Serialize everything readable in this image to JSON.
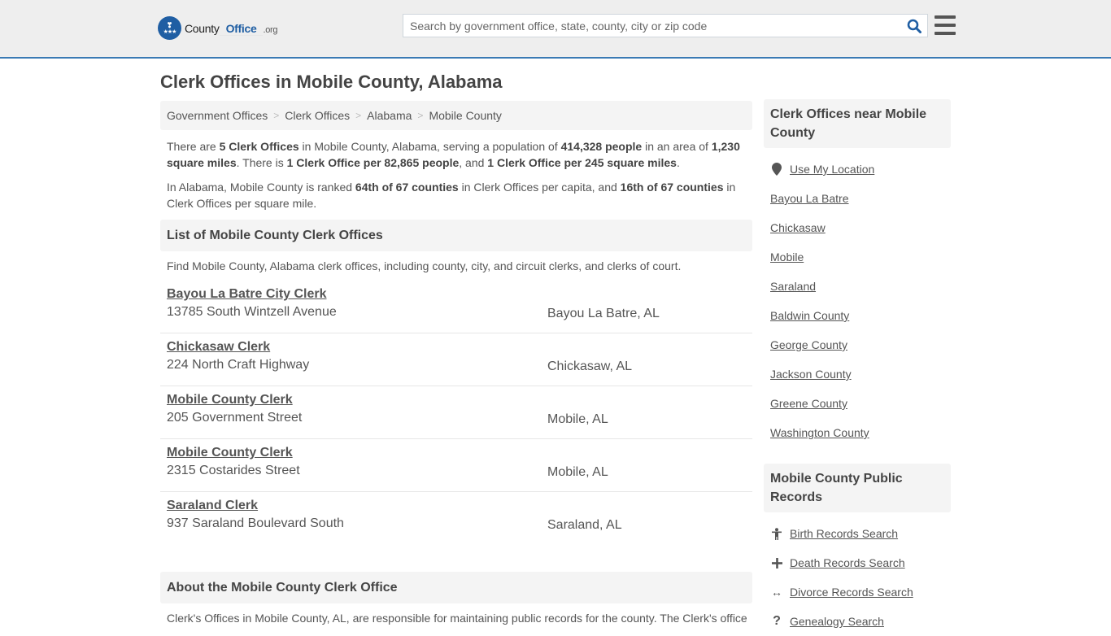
{
  "header": {
    "logo": {
      "county": "County",
      "office": "Office",
      "org": ".org"
    },
    "search": {
      "placeholder": "Search by government office, state, county, city or zip code",
      "value": ""
    },
    "colors": {
      "brand": "#1f5ea3",
      "header_bg": "#eeeeee",
      "header_border": "#3a7ab4"
    }
  },
  "page": {
    "title": "Clerk Offices in Mobile County, Alabama"
  },
  "breadcrumb": [
    {
      "label": "Government Offices"
    },
    {
      "label": "Clerk Offices"
    },
    {
      "label": "Alabama"
    },
    {
      "label": "Mobile County"
    }
  ],
  "intro": {
    "p1": {
      "t1": "There are ",
      "b1": "5 Clerk Offices",
      "t2": " in Mobile County, Alabama, serving a population of ",
      "b2": "414,328 people",
      "t3": " in an area of ",
      "b3": "1,230 square miles",
      "t4": ". There is ",
      "b4": "1 Clerk Office per 82,865 people",
      "t5": ", and ",
      "b5": "1 Clerk Office per 245 square miles",
      "t6": "."
    },
    "p2": {
      "t1": "In Alabama, Mobile County is ranked ",
      "b1": "64th of 67 counties",
      "t2": " in Clerk Offices per capita, and ",
      "b2": "16th of 67 counties",
      "t3": " in Clerk Offices per square mile."
    }
  },
  "list": {
    "heading": "List of Mobile County Clerk Offices",
    "description": "Find Mobile County, Alabama clerk offices, including county, city, and circuit clerks, and clerks of court.",
    "offices": [
      {
        "name": "Bayou La Batre City Clerk",
        "address": "13785 South Wintzell Avenue",
        "city": "Bayou La Batre, AL"
      },
      {
        "name": "Chickasaw Clerk",
        "address": "224 North Craft Highway",
        "city": "Chickasaw, AL"
      },
      {
        "name": "Mobile County Clerk",
        "address": "205 Government Street",
        "city": "Mobile, AL"
      },
      {
        "name": "Mobile County Clerk",
        "address": "2315 Costarides Street",
        "city": "Mobile, AL"
      },
      {
        "name": "Saraland Clerk",
        "address": "937 Saraland Boulevard South",
        "city": "Saraland, AL"
      }
    ]
  },
  "about": {
    "heading": "About the Mobile County Clerk Office",
    "text": "Clerk's Offices in Mobile County, AL, are responsible for maintaining public records for the county. The Clerk's office"
  },
  "sidebar": {
    "nearby": {
      "heading": "Clerk Offices near Mobile County",
      "use_location": "Use My Location",
      "items": [
        "Bayou La Batre",
        "Chickasaw",
        "Mobile",
        "Saraland",
        "Baldwin County",
        "George County",
        "Jackson County",
        "Greene County",
        "Washington County"
      ]
    },
    "records": {
      "heading": "Mobile County Public Records",
      "items": [
        {
          "label": "Birth Records Search",
          "icon": "child-icon"
        },
        {
          "label": "Death Records Search",
          "icon": "plus-icon"
        },
        {
          "label": "Divorce Records Search",
          "icon": "arrows-horizontal-icon"
        },
        {
          "label": "Genealogy Search",
          "icon": "question-icon"
        }
      ]
    }
  }
}
